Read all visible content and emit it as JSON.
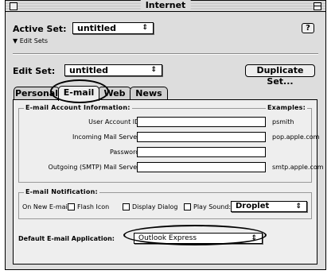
{
  "window": {
    "title": "Internet"
  },
  "active_set": {
    "label": "Active Set:",
    "value": "untitled",
    "edit_sets_label": "Edit Sets",
    "help_label": "?"
  },
  "edit_set": {
    "label": "Edit Set:",
    "value": "untitled",
    "duplicate_label": "Duplicate Set..."
  },
  "tabs": [
    {
      "label": "Personal",
      "selected": false
    },
    {
      "label": "E-mail",
      "selected": true
    },
    {
      "label": "Web",
      "selected": false
    },
    {
      "label": "News",
      "selected": false
    }
  ],
  "account_info": {
    "title": "E-mail Account Information:",
    "examples_label": "Examples:",
    "fields": [
      {
        "label": "User Account ID:",
        "value": "",
        "example": "psmith"
      },
      {
        "label": "Incoming Mail Server:",
        "value": "",
        "example": "pop.apple.com"
      },
      {
        "label": "Password:",
        "value": "",
        "example": ""
      },
      {
        "label": "Outgoing (SMTP) Mail Server:",
        "value": "",
        "example": "smtp.apple.com"
      }
    ]
  },
  "notification": {
    "title": "E-mail Notification:",
    "prefix": "On New E-mail:",
    "options": [
      {
        "label": "Flash Icon",
        "checked": false
      },
      {
        "label": "Display Dialog",
        "checked": false
      },
      {
        "label": "Play Sound:",
        "checked": false
      }
    ],
    "sound_value": "Droplet"
  },
  "default_app": {
    "label": "Default E-mail Application:",
    "value": "Outlook Express"
  },
  "icons": {
    "popup_arrows": "up-down-arrows-icon",
    "disclosure": "triangle-down-icon"
  }
}
